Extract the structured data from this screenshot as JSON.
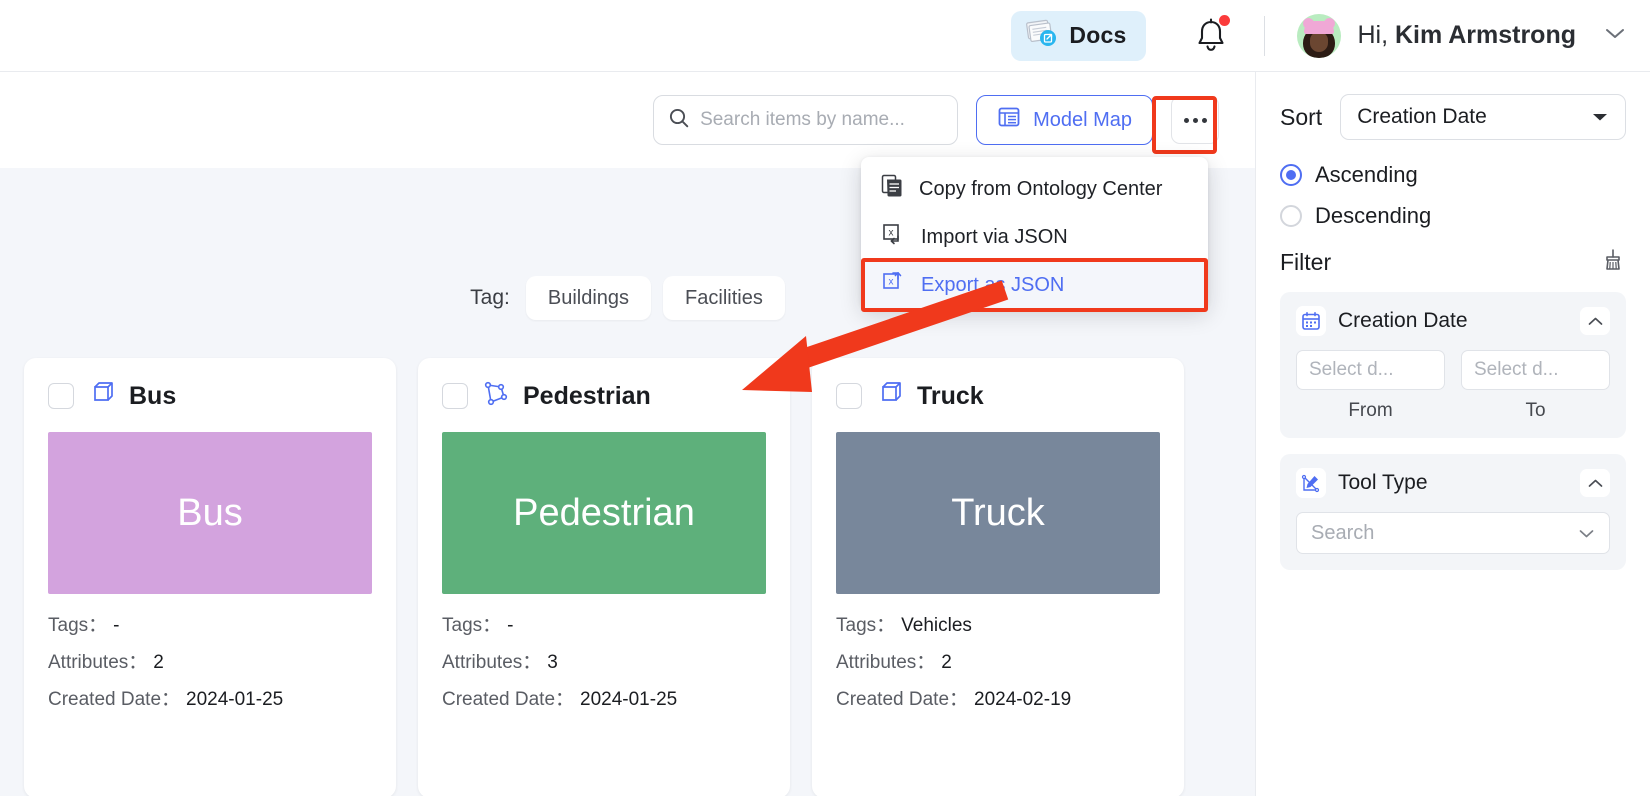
{
  "topbar": {
    "docs_label": "Docs",
    "docs_icon": "documents-icon",
    "bell_icon": "notification-bell-icon",
    "has_notification": true,
    "greeting_prefix": "Hi, ",
    "user_name": "Kim Armstrong",
    "chevron_icon": "chevron-down-icon"
  },
  "toolbar": {
    "search_placeholder": "Search items by name...",
    "search_value": "",
    "search_icon": "search-icon",
    "model_map_label": "Model Map",
    "model_map_icon": "list-view-icon",
    "more_icon": "ellipsis-icon"
  },
  "menu": {
    "items": [
      {
        "label": "Copy from Ontology Center",
        "icon": "copy-document-icon",
        "highlighted": false
      },
      {
        "label": "Import via JSON",
        "icon": "import-json-icon",
        "highlighted": false
      },
      {
        "label": "Export as JSON",
        "icon": "export-json-icon",
        "highlighted": true
      }
    ]
  },
  "main": {
    "tag_label": "Tag:",
    "tag_chips": [
      "Buildings",
      "Facilities"
    ],
    "cards": [
      {
        "title": "Bus",
        "icon": "cube-3d-icon",
        "thumb_text": "Bus",
        "thumb_color": "#d3a3de",
        "tags_key": "Tags：",
        "tags_value": "-",
        "attributes_key": "Attributes：",
        "attributes_value": "2",
        "created_key": "Created Date：",
        "created_value": "2024-01-25"
      },
      {
        "title": "Pedestrian",
        "icon": "polygon-icon",
        "thumb_text": "Pedestrian",
        "thumb_color": "#5eb07b",
        "tags_key": "Tags：",
        "tags_value": "-",
        "attributes_key": "Attributes：",
        "attributes_value": "3",
        "created_key": "Created Date：",
        "created_value": "2024-01-25"
      },
      {
        "title": "Truck",
        "icon": "cube-3d-icon",
        "thumb_text": "Truck",
        "thumb_color": "#78879b",
        "tags_key": "Tags：",
        "tags_value": "Vehicles",
        "attributes_key": "Attributes：",
        "attributes_value": "2",
        "created_key": "Created Date：",
        "created_value": "2024-02-19"
      }
    ]
  },
  "sidebar": {
    "sort_label": "Sort",
    "sort_value": "Creation Date",
    "sort_chevron": "chevron-down-icon",
    "order_options": [
      {
        "label": "Ascending",
        "selected": true
      },
      {
        "label": "Descending",
        "selected": false
      }
    ],
    "filter_label": "Filter",
    "clear_filter_icon": "broom-icon",
    "filters": [
      {
        "title": "Creation Date",
        "icon": "calendar-icon",
        "toggle_icon": "chevron-up-icon",
        "from_placeholder": "Select d...",
        "from_value": "",
        "from_caption": "From",
        "to_placeholder": "Select d...",
        "to_value": "",
        "to_caption": "To"
      },
      {
        "title": "Tool Type",
        "icon": "annotation-tool-icon",
        "toggle_icon": "chevron-up-icon",
        "search_placeholder": "Search",
        "search_chevron": "chevron-down-icon"
      }
    ]
  },
  "annotations": {
    "highlight_color": "#f0391c",
    "arrow_target": "Export as JSON menu item",
    "box_targets": [
      "more-options-button",
      "export-as-json-menu-item"
    ]
  }
}
